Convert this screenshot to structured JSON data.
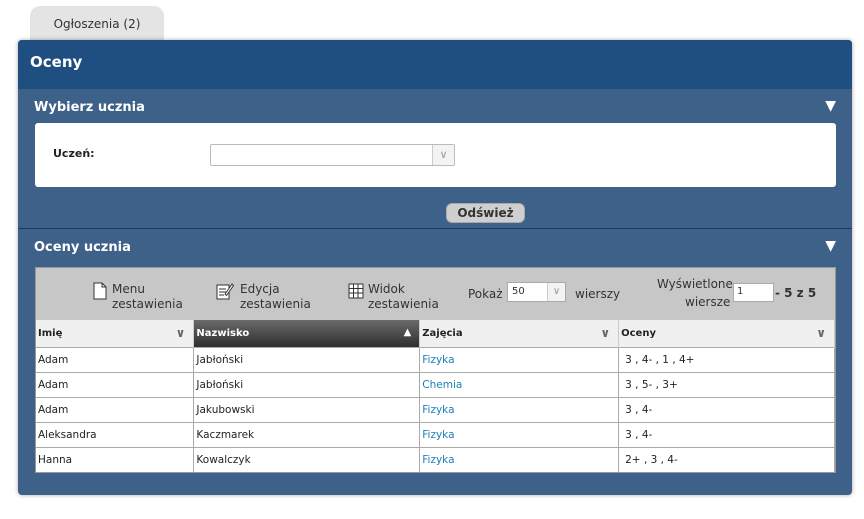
{
  "tab": {
    "label": "Ogłoszenia (2)"
  },
  "panel": {
    "title": "Oceny"
  },
  "student_section": {
    "title": "Wybierz ucznia",
    "label": "Uczeń:",
    "selected": "",
    "refresh_label": "Odśwież"
  },
  "grades_section": {
    "title": "Oceny ucznia",
    "toolbar": {
      "menu_line1": "Menu",
      "menu_line2": "zestawienia",
      "edit_line1": "Edycja",
      "edit_line2": "zestawienia",
      "view_line1": "Widok",
      "view_line2": "zestawienia",
      "show_label": "Pokaż",
      "page_size": "50",
      "rows_label": "wierszy",
      "displayed_line1": "Wyświetlone",
      "displayed_line2": "wiersze",
      "range_start": "1",
      "range_rest": "- 5 z 5"
    },
    "columns": [
      "Imię",
      "Nazwisko",
      "Zajęcia",
      "Oceny"
    ],
    "rows": [
      [
        "Adam",
        "Jabłoński",
        "Fizyka",
        "3 , 4- , 1 , 4+"
      ],
      [
        "Adam",
        "Jabłoński",
        "Chemia",
        "3 , 5- , 3+"
      ],
      [
        "Adam",
        "Jakubowski",
        "Fizyka",
        "3 , 4-"
      ],
      [
        "Aleksandra",
        "Kaczmarek",
        "Fizyka",
        "3 , 4-"
      ],
      [
        "Hanna",
        "Kowalczyk",
        "Fizyka",
        "2+ , 3 , 4-"
      ]
    ]
  },
  "icons": {
    "collapse": "triangle-down-icon",
    "menu": "document-icon",
    "edit": "edit-icon",
    "view": "table-grid-icon",
    "sort_asc": "triangle-up-icon",
    "sort_menu": "chevron-down-icon"
  },
  "colors": {
    "header": "#1f4f80",
    "body": "#3d6189",
    "link": "#1a7fb8"
  }
}
